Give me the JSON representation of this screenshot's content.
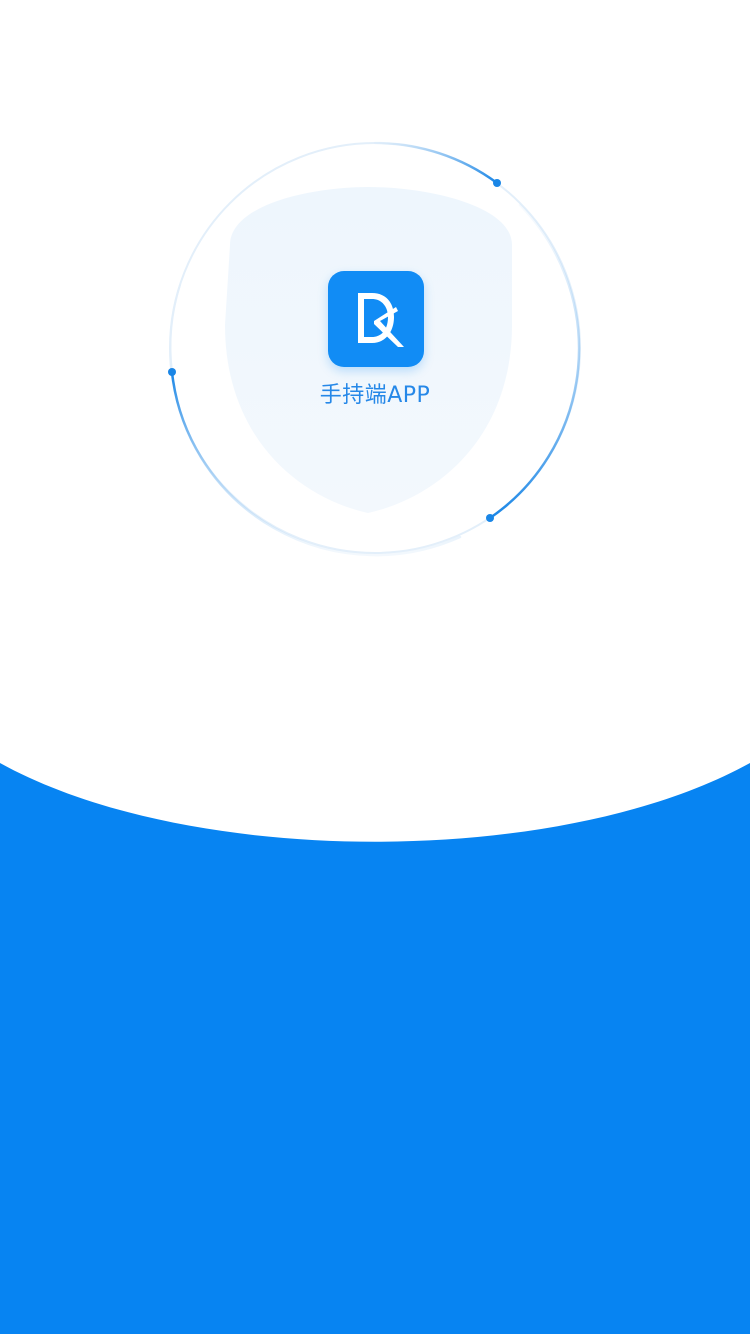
{
  "app": {
    "name": "手持端APP"
  },
  "icons": {
    "logo": "app-logo-icon",
    "shield": "shield-icon"
  },
  "colors": {
    "brand_blue": "#0784f2",
    "icon_blue": "#118cf5",
    "text_blue": "#2688e8",
    "shield_fill": "#f0f7fd",
    "ring_light": "#d7e9f9",
    "ring_accent": "#1a86e6"
  }
}
